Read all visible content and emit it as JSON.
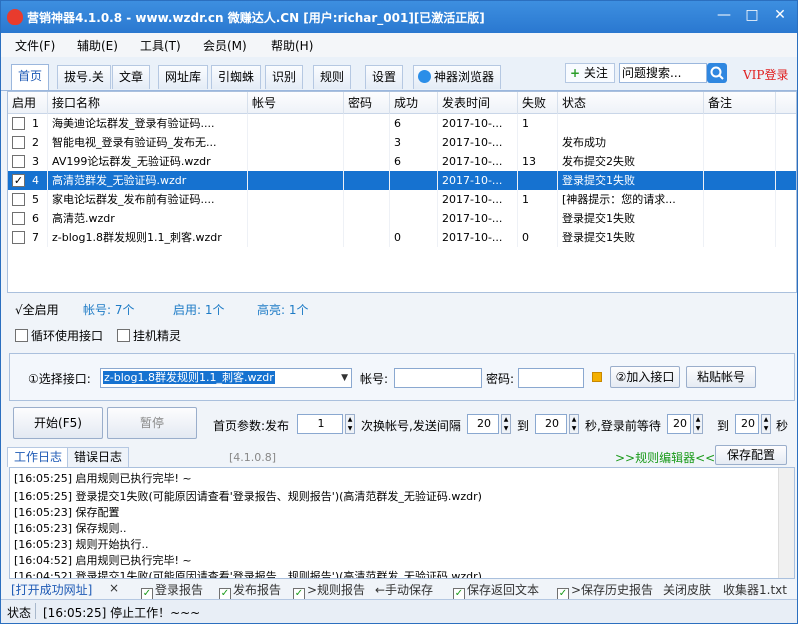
{
  "window": {
    "title": "营销神器4.1.0.8 - www.wzdr.cn 微赚达人.CN [用户:richar_001][已激活正版]",
    "minimize": "—",
    "maximize": "□",
    "close": "✕"
  },
  "menu": [
    "文件(F)",
    "辅助(E)",
    "工具(T)",
    "会员(M)",
    "帮助(H)"
  ],
  "tabs": [
    "首页",
    "拔号.关",
    "文章",
    "网址库",
    "引蜘蛛",
    "识别",
    "规则",
    "设置",
    "神器浏览器"
  ],
  "toolbar": {
    "follow": "关注",
    "search_placeholder": "问题搜索...",
    "vip": "VIP登录"
  },
  "grid": {
    "headers": [
      "启用",
      "接口名称",
      "帐号",
      "密码",
      "成功",
      "发表时间",
      "失败",
      "状态",
      "备注"
    ],
    "rows": [
      {
        "checked": false,
        "num": "1",
        "name": "海美迪论坛群发_登录有验证码....",
        "account": "",
        "password": "",
        "success": "6",
        "time": "2017-10-...",
        "fail": "1",
        "status": "",
        "note": ""
      },
      {
        "checked": false,
        "num": "2",
        "name": "智能电视_登录有验证码_发布无...",
        "account": "",
        "password": "",
        "success": "3",
        "time": "2017-10-...",
        "fail": "",
        "status": "发布成功",
        "note": ""
      },
      {
        "checked": false,
        "num": "3",
        "name": "AV199论坛群发_无验证码.wzdr",
        "account": "",
        "password": "",
        "success": "6",
        "time": "2017-10-...",
        "fail": "13",
        "status": "发布提交2失败",
        "note": ""
      },
      {
        "checked": true,
        "num": "4",
        "name": "高清范群发_无验证码.wzdr",
        "account": "",
        "password": "",
        "success": "",
        "time": "2017-10-...",
        "fail": "",
        "status": "登录提交1失败",
        "note": ""
      },
      {
        "checked": false,
        "num": "5",
        "name": "家电论坛群发_发布前有验证码....",
        "account": "",
        "password": "",
        "success": "",
        "time": "2017-10-...",
        "fail": "1",
        "status": "[神器提示：您的请求...",
        "note": ""
      },
      {
        "checked": false,
        "num": "6",
        "name": "高清范.wzdr",
        "account": "",
        "password": "",
        "success": "",
        "time": "2017-10-...",
        "fail": "",
        "status": "登录提交1失败",
        "note": ""
      },
      {
        "checked": false,
        "num": "7",
        "name": "z-blog1.8群发规则1.1_刺客.wzdr",
        "account": "",
        "password": "",
        "success": "0",
        "time": "2017-10-...",
        "fail": "0",
        "status": "登录提交1失败",
        "note": ""
      }
    ]
  },
  "summary": {
    "enable_all": "√全启用",
    "account_count": "帐号: 7个",
    "enabled": "启用: 1个",
    "highlighted": "高亮: 1个"
  },
  "options": {
    "loop": "循环使用接口",
    "hang": "挂机精灵"
  },
  "interface_panel": {
    "select_label": "①选择接口:",
    "selected": "z-blog1.8群发规则1.1_刺客.wzdr",
    "account_label": "帐号:",
    "password_label": "密码:",
    "add_button": "②加入接口",
    "paste_button": "粘贴帐号"
  },
  "controls": {
    "start": "开始(F5)",
    "pause": "暂停",
    "params_label": "首页参数:发布",
    "publish_count": "1",
    "switch_label": "次换帐号,发送间隔",
    "interval_from": "20",
    "to1": "到",
    "interval_to": "20",
    "wait_label": "秒,登录前等待",
    "wait_from": "20",
    "to2": "到",
    "wait_to": "20",
    "sec": "秒"
  },
  "log": {
    "tab_work": "工作日志",
    "tab_error": "错误日志",
    "version": "[4.1.0.8]",
    "rule_editor": ">>规则编辑器<<",
    "save_config": "保存配置",
    "lines": [
      "[16:05:25] 启用规则已执行完毕! ~",
      "[16:05:25] 登录提交1失败(可能原因请查看'登录报告、规则报告')(高清范群发_无验证码.wzdr)",
      "[16:05:23] 保存配置",
      "[16:05:23] 保存规则..",
      "[16:05:23] 规则开始执行..",
      "[16:04:52] 启用规则已执行完毕! ~",
      "[16:04:52] 登录提交1失败(可能原因请查看'登录报告、规则报告')(高清范群发_无验证码.wzdr)"
    ]
  },
  "bottom": {
    "open_site": "[打开成功网址]",
    "close_x": "×",
    "login_report": "登录报告",
    "publish_report": "发布报告",
    "rule_report": ">规则报告",
    "manual_save": "←手动保存",
    "save_return": "保存返回文本",
    "save_history": ">保存历史报告",
    "close_skin": "关闭皮肤",
    "collector": "收集器1.txt"
  },
  "status": {
    "label": "状态",
    "text": "[16:05:25] 停止工作！~~~"
  }
}
